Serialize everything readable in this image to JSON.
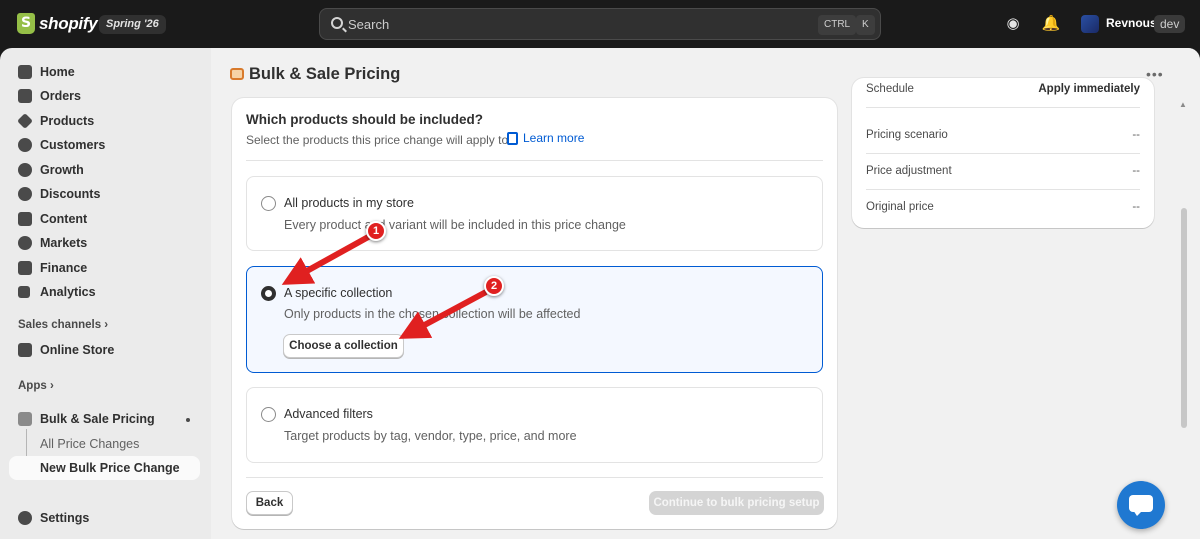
{
  "topbar": {
    "logo_text": "shopify",
    "edition": "Spring '26",
    "search_placeholder": "Search",
    "kbd_ctrl": "CTRL",
    "kbd_k": "K",
    "store_name": "Revnous",
    "store_tag": "dev"
  },
  "sidebar": {
    "items": [
      {
        "label": "Home",
        "icon": "home-icon"
      },
      {
        "label": "Orders",
        "icon": "orders-icon"
      },
      {
        "label": "Products",
        "icon": "tag-icon"
      },
      {
        "label": "Customers",
        "icon": "person-icon"
      },
      {
        "label": "Growth",
        "icon": "growth-icon"
      },
      {
        "label": "Discounts",
        "icon": "discount-icon"
      },
      {
        "label": "Content",
        "icon": "content-icon"
      },
      {
        "label": "Markets",
        "icon": "globe-icon"
      },
      {
        "label": "Finance",
        "icon": "bank-icon"
      },
      {
        "label": "Analytics",
        "icon": "chart-icon"
      }
    ],
    "sales_channels": "Sales channels",
    "online_store": "Online Store",
    "apps": "Apps",
    "app_name": "Bulk & Sale Pricing",
    "sub_items": [
      "All Price Changes",
      "New Bulk Price Change"
    ],
    "settings": "Settings"
  },
  "page": {
    "title": "Bulk & Sale Pricing"
  },
  "form": {
    "question": "Which products should be included?",
    "subtitle": "Select the products this price change will apply to",
    "learn_more": "Learn more",
    "options": [
      {
        "title": "All products in my store",
        "desc": "Every product and variant will be included in this price change",
        "selected": false
      },
      {
        "title": "A specific collection",
        "desc": "Only products in the chosen collection will be affected",
        "selected": true
      },
      {
        "title": "Advanced filters",
        "desc": "Target products by tag, vendor, type, price, and more",
        "selected": false
      }
    ],
    "choose_collection": "Choose a collection",
    "back": "Back",
    "continue": "Continue to bulk pricing setup"
  },
  "summary": {
    "rows": [
      {
        "key": "Schedule",
        "value": "Apply immediately"
      },
      {
        "key": "Pricing scenario",
        "value": "--"
      },
      {
        "key": "Price adjustment",
        "value": "--"
      },
      {
        "key": "Original price",
        "value": "--"
      }
    ]
  },
  "annotations": [
    "1",
    "2"
  ],
  "colors": {
    "accent": "#005bd3",
    "annotation": "#e02020"
  }
}
